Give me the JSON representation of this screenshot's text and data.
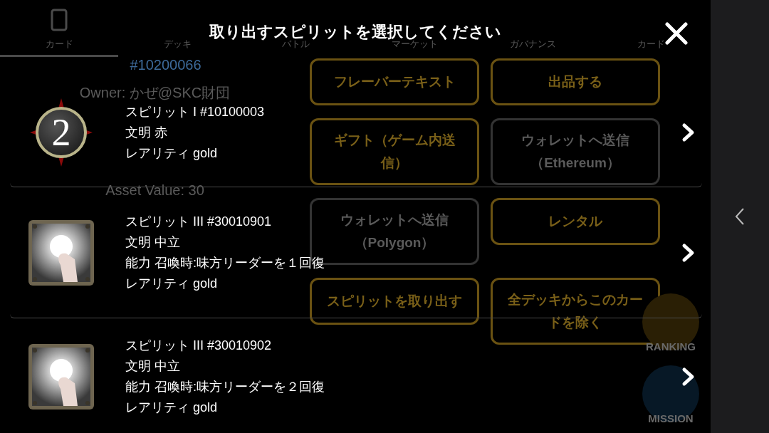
{
  "background": {
    "tabs": [
      {
        "label": "カード",
        "selected": true
      },
      {
        "label": "デッキ",
        "selected": false
      },
      {
        "label": "バトル",
        "selected": false
      },
      {
        "label": "マーケット",
        "selected": false
      },
      {
        "label": "ガバナンス",
        "selected": false
      },
      {
        "label": "カード",
        "selected": false
      }
    ],
    "card_id": "#10200066",
    "owner": "Owner: かぜ@SKC財団",
    "asset_value": "Asset Value: 30",
    "actions": [
      {
        "label": "フレーバーテキスト",
        "disabled": false
      },
      {
        "label": "出品する",
        "disabled": false
      },
      {
        "label": "ギフト（ゲーム内送信）",
        "disabled": false
      },
      {
        "label": "ウォレットへ送信（Ethereum）",
        "disabled": true
      },
      {
        "label": "ウォレットへ送信（Polygon）",
        "disabled": true
      },
      {
        "label": "レンタル",
        "disabled": false
      },
      {
        "label": "スピリットを取り出す",
        "disabled": false
      },
      {
        "label": "全デッキからこのカードを除く",
        "disabled": false
      }
    ],
    "floating": [
      {
        "label": "RANKING",
        "kind": "ranking"
      },
      {
        "label": "MISSION",
        "kind": "mission"
      }
    ]
  },
  "dialog": {
    "title": "取り出すスピリットを選択してください",
    "spirits": [
      {
        "kind": "badge",
        "badge": "2",
        "lines": [
          "スピリット I #10100003",
          "文明 赤",
          "レアリティ gold"
        ]
      },
      {
        "kind": "picture",
        "lines": [
          "スピリット III #30010901",
          "文明 中立",
          "能力 召喚時:味方リーダーを１回復",
          "レアリティ gold"
        ]
      },
      {
        "kind": "picture",
        "lines": [
          "スピリット III #30010902",
          "文明 中立",
          "能力 召喚時:味方リーダーを２回復",
          "レアリティ gold"
        ]
      }
    ]
  }
}
